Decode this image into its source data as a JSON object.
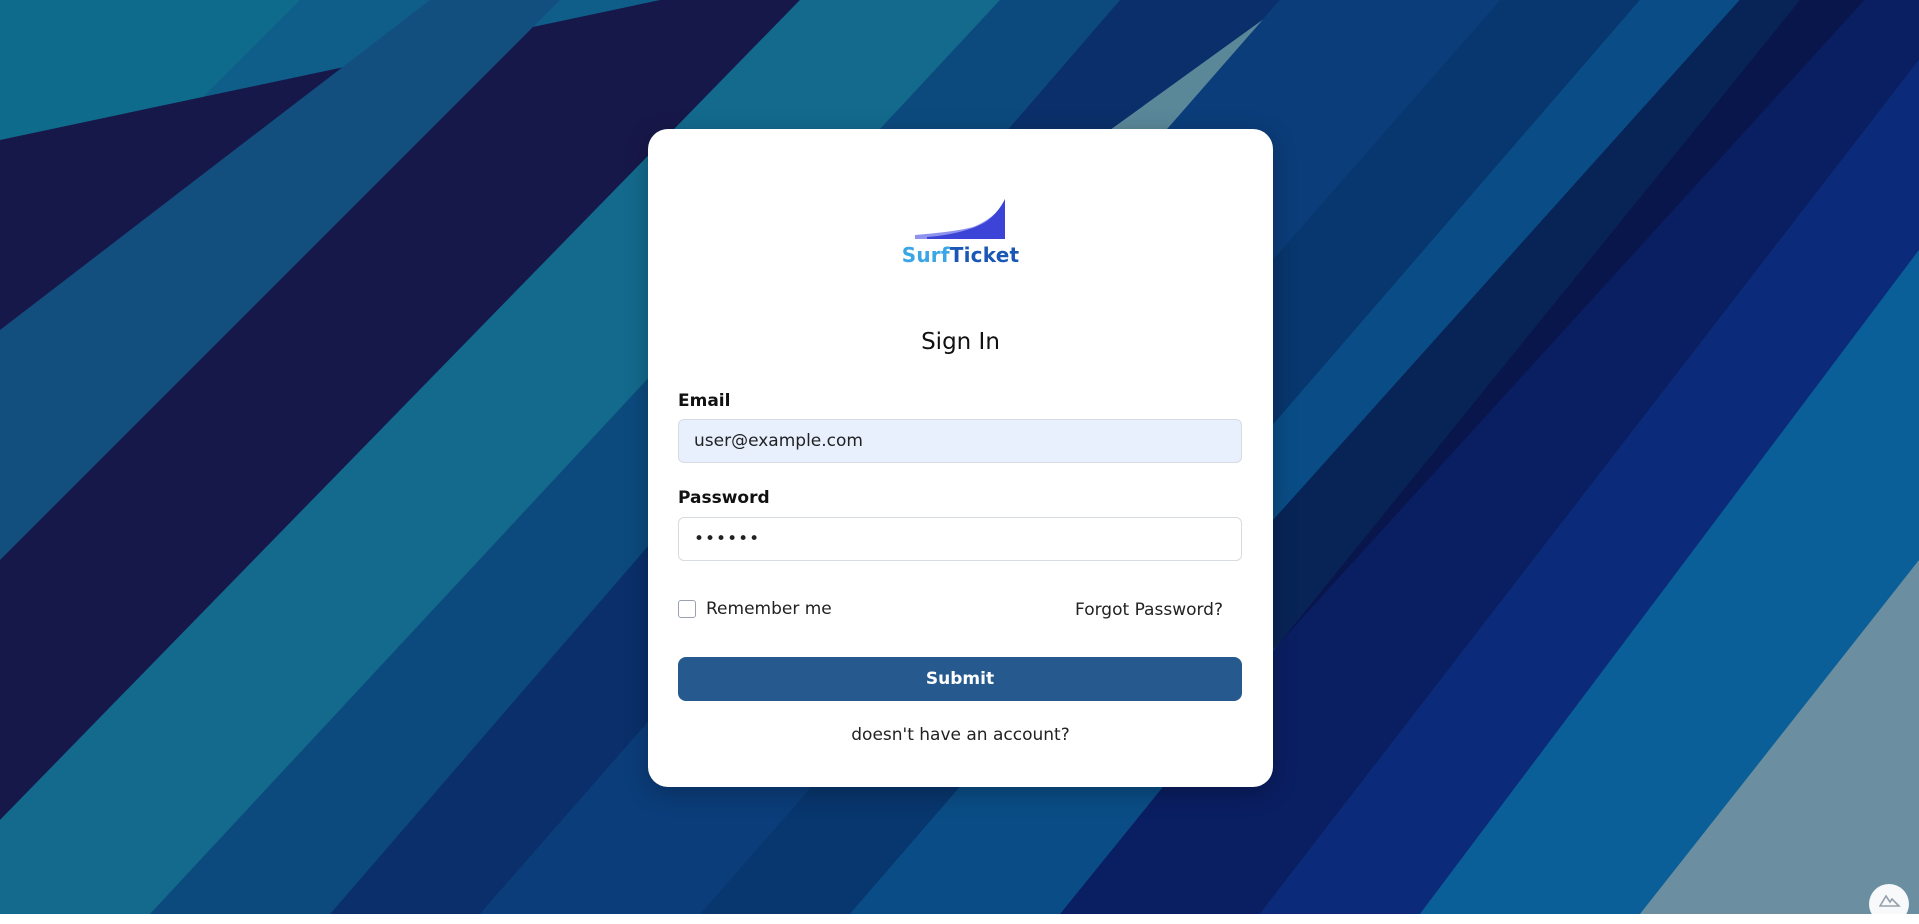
{
  "brand": {
    "name_part1": "Surf",
    "name_part2": "Ticket",
    "color_primary": "#1a57b6",
    "color_secondary": "#3aa6e6"
  },
  "form": {
    "title": "Sign In",
    "email_label": "Email",
    "email_value": "user@example.com",
    "password_label": "Password",
    "password_value": "••••••",
    "remember_label": "Remember me",
    "remember_checked": false,
    "forgot_label": "Forgot Password?",
    "submit_label": "Submit",
    "signup_link": "doesn't have an account?"
  },
  "colors": {
    "submit_bg": "#265a8e",
    "email_bg": "#e8f0fe"
  },
  "icons": {
    "logo": "wave-logo-icon",
    "corner": "nuxt-icon"
  }
}
